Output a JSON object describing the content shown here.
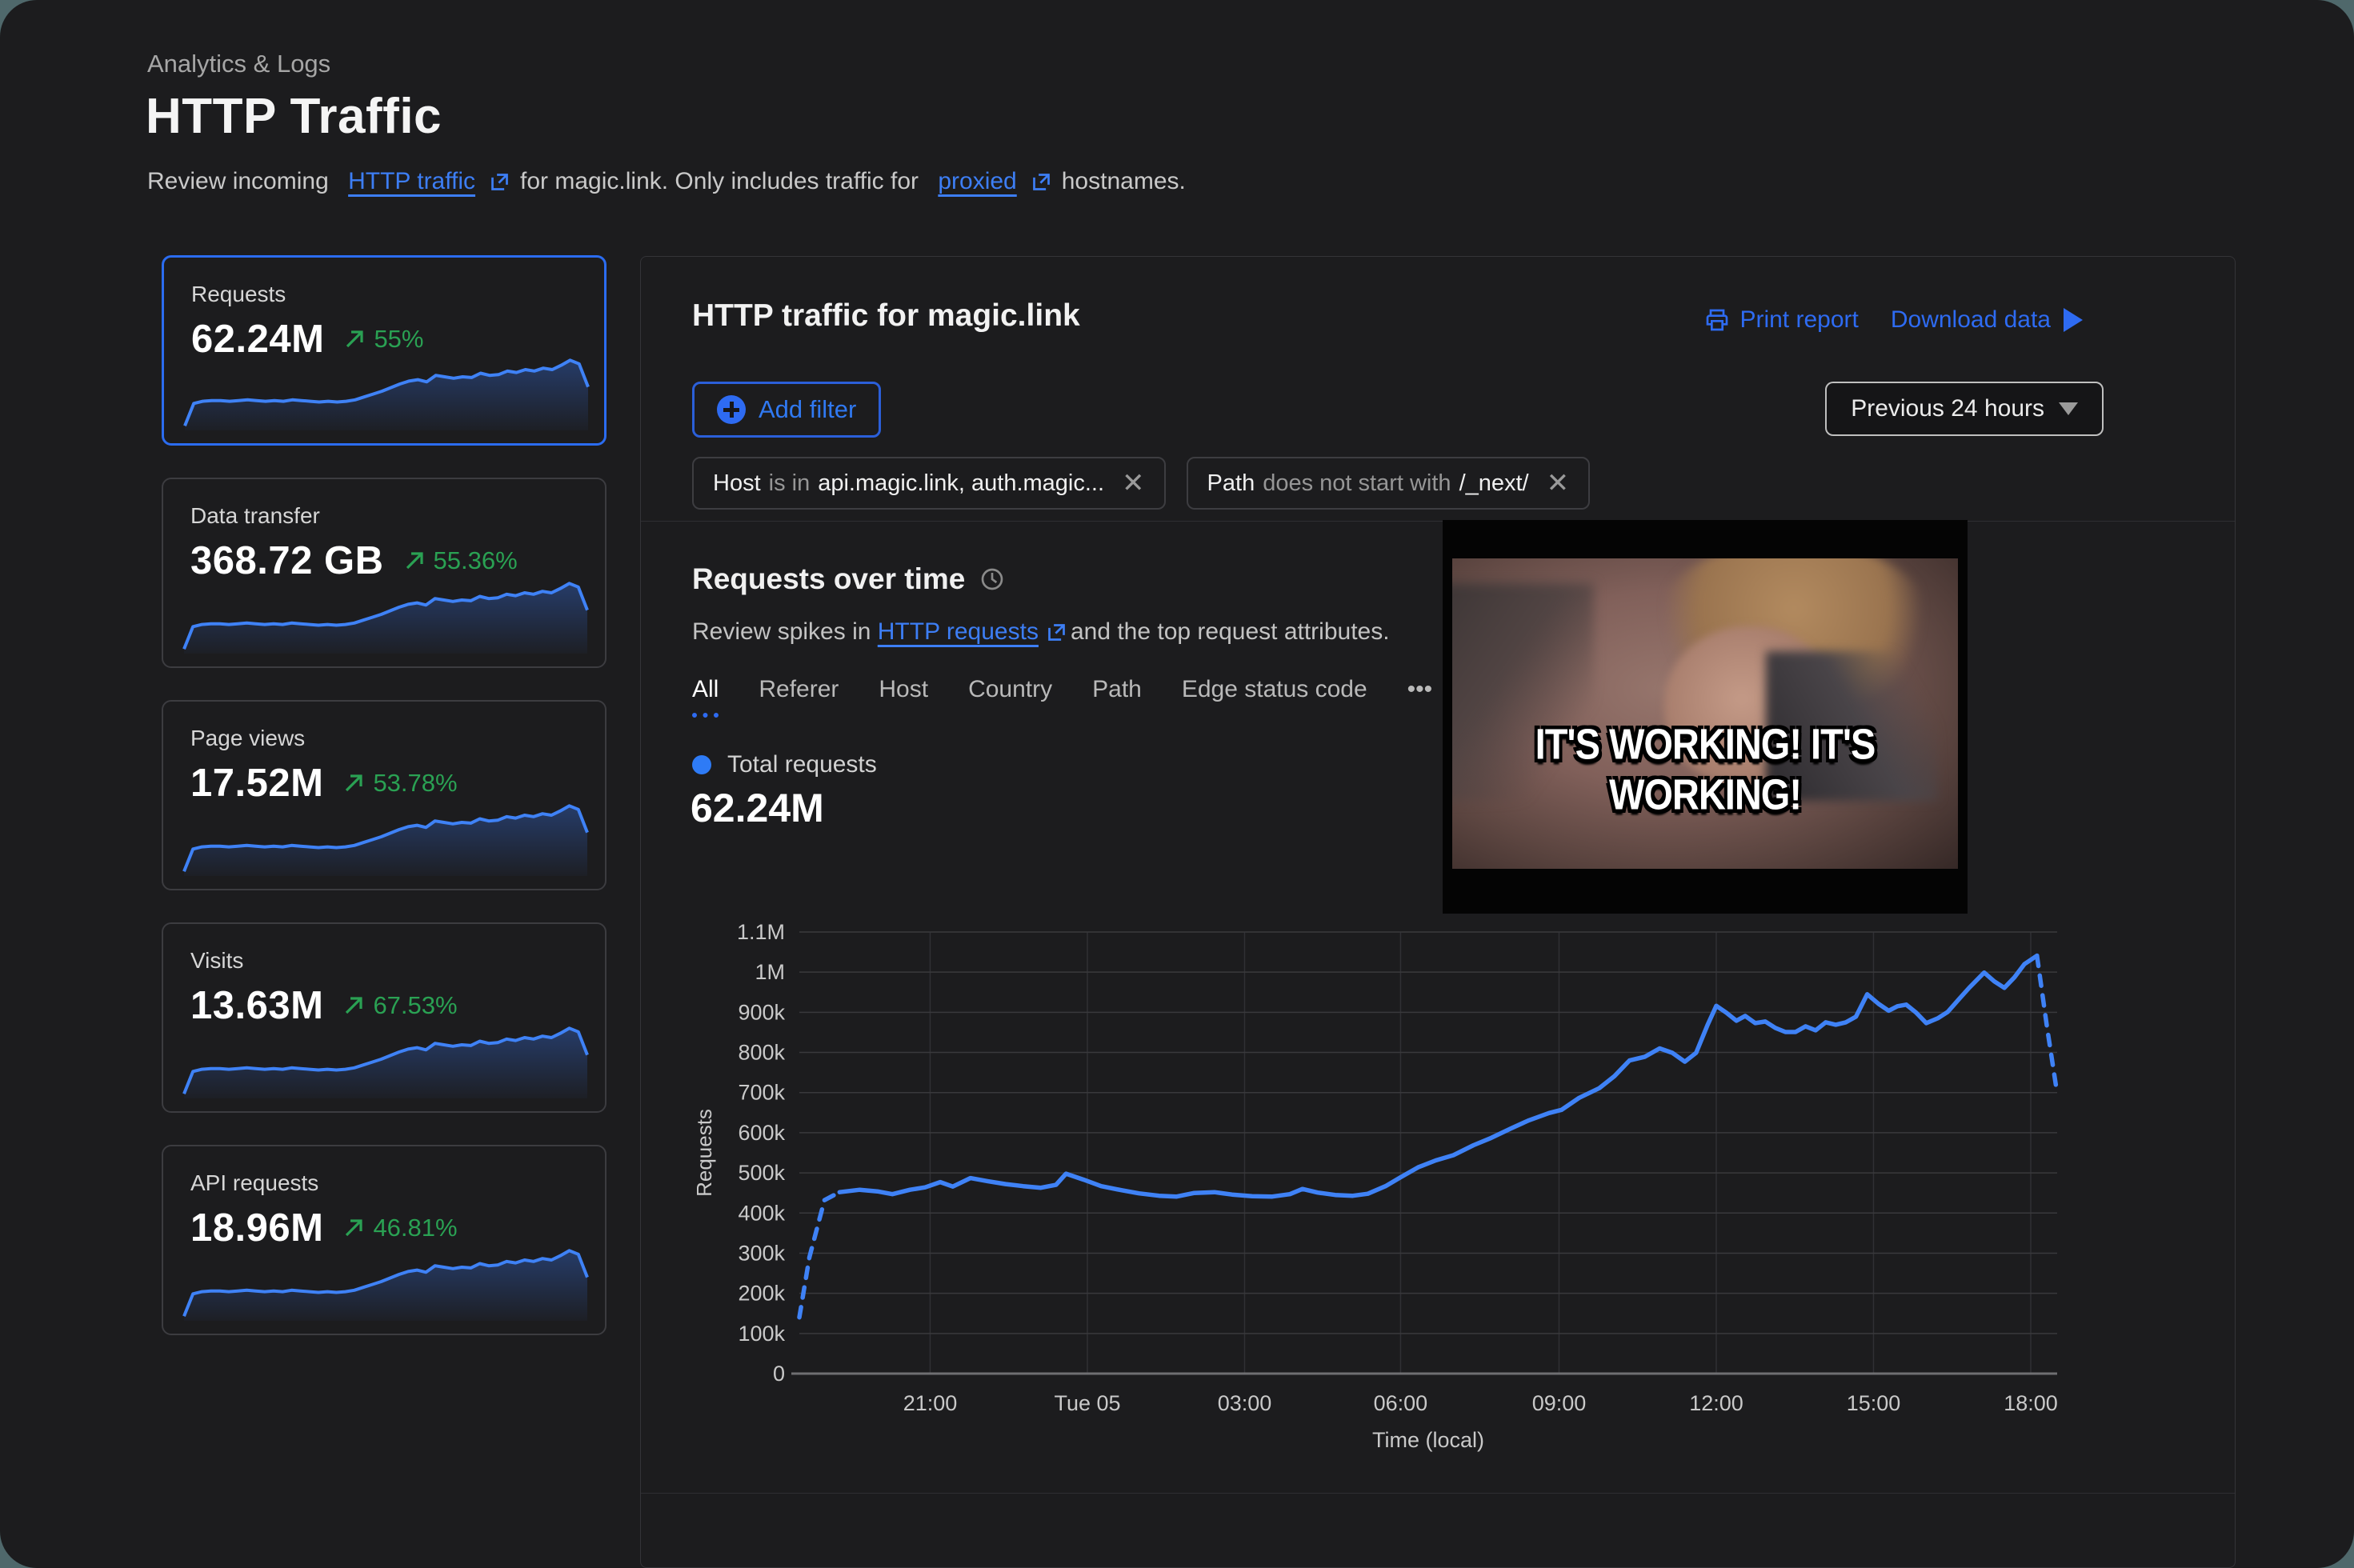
{
  "page": {
    "eyebrow": "Analytics & Logs",
    "title": "HTTP Traffic",
    "description": {
      "pre": "Review incoming",
      "link1": "HTTP traffic",
      "mid": "for magic.link. Only includes traffic for",
      "link2": "proxied",
      "post": "hostnames."
    }
  },
  "cards": [
    {
      "label": "Requests",
      "value": "62.24M",
      "delta": "55%"
    },
    {
      "label": "Data transfer",
      "value": "368.72 GB",
      "delta": "55.36%"
    },
    {
      "label": "Page views",
      "value": "17.52M",
      "delta": "53.78%"
    },
    {
      "label": "Visits",
      "value": "13.63M",
      "delta": "67.53%"
    },
    {
      "label": "API requests",
      "value": "18.96M",
      "delta": "46.81%"
    }
  ],
  "panel": {
    "title": "HTTP traffic for magic.link",
    "print_label": "Print report",
    "download_label": "Download data",
    "time_range": "Previous 24 hours",
    "add_filter_label": "Add filter",
    "filters": [
      {
        "field": "Host",
        "operator": "is in",
        "value": "api.magic.link, auth.magic...",
        "close": "✕"
      },
      {
        "field": "Path",
        "operator": "does not start with",
        "value": "/_next/",
        "close": "✕"
      }
    ]
  },
  "section": {
    "heading": "Requests over time",
    "description": {
      "pre": "Review spikes in",
      "link": "HTTP requests",
      "post": "and the top request attributes."
    },
    "tabs": [
      "All",
      "Referer",
      "Host",
      "Country",
      "Path",
      "Edge status code",
      "•••"
    ],
    "active_tab": "All",
    "legend_label": "Total requests",
    "total_value": "62.24M"
  },
  "meme": {
    "caption": "IT'S WORKING! IT'S WORKING!"
  },
  "colors": {
    "accent_blue": "#2e6bf2",
    "chart_line": "#3f82f6",
    "positive_green": "#2aa153",
    "grid": "#39393c",
    "axis_text": "#c9c9c9"
  },
  "sparkline": {
    "values": [
      0.02,
      0.33,
      0.36,
      0.37,
      0.37,
      0.36,
      0.37,
      0.38,
      0.37,
      0.36,
      0.37,
      0.36,
      0.38,
      0.37,
      0.36,
      0.35,
      0.36,
      0.35,
      0.36,
      0.38,
      0.42,
      0.46,
      0.5,
      0.55,
      0.6,
      0.64,
      0.66,
      0.63,
      0.72,
      0.7,
      0.68,
      0.7,
      0.69,
      0.75,
      0.72,
      0.73,
      0.78,
      0.76,
      0.8,
      0.78,
      0.82,
      0.8,
      0.86,
      0.93,
      0.88,
      0.56
    ]
  },
  "chart_data": {
    "type": "line",
    "title": "Requests over time",
    "xlabel": "Time (local)",
    "ylabel": "Requests",
    "ylim": [
      0,
      1100000
    ],
    "grid": true,
    "legend_position": "top-left",
    "y_ticks": [
      {
        "value": 0,
        "label": "0"
      },
      {
        "value": 100,
        "label": "100k"
      },
      {
        "value": 200,
        "label": "200k"
      },
      {
        "value": 300,
        "label": "300k"
      },
      {
        "value": 400,
        "label": "400k"
      },
      {
        "value": 500,
        "label": "500k"
      },
      {
        "value": 600,
        "label": "600k"
      },
      {
        "value": 700,
        "label": "700k"
      },
      {
        "value": 800,
        "label": "800k"
      },
      {
        "value": 900,
        "label": "900k"
      },
      {
        "value": 1000,
        "label": "1M"
      },
      {
        "value": 1100,
        "label": "1.1M"
      }
    ],
    "x_ticks": [
      {
        "frac": 0.104,
        "label": "21:00"
      },
      {
        "frac": 0.229,
        "label": "Tue 05"
      },
      {
        "frac": 0.354,
        "label": "03:00"
      },
      {
        "frac": 0.478,
        "label": "06:00"
      },
      {
        "frac": 0.604,
        "label": "09:00"
      },
      {
        "frac": 0.729,
        "label": "12:00"
      },
      {
        "frac": 0.854,
        "label": "15:00"
      },
      {
        "frac": 0.979,
        "label": "18:00"
      }
    ],
    "series": [
      {
        "name": "Total requests",
        "units": "requests, thousands",
        "dash_head_until": 3,
        "dash_tail_from": 87,
        "points": [
          [
            0.0,
            140
          ],
          [
            0.008,
            290
          ],
          [
            0.02,
            432
          ],
          [
            0.032,
            452
          ],
          [
            0.048,
            458
          ],
          [
            0.062,
            454
          ],
          [
            0.074,
            447
          ],
          [
            0.088,
            458
          ],
          [
            0.1,
            464
          ],
          [
            0.112,
            477
          ],
          [
            0.122,
            466
          ],
          [
            0.136,
            487
          ],
          [
            0.15,
            479
          ],
          [
            0.164,
            472
          ],
          [
            0.178,
            467
          ],
          [
            0.192,
            463
          ],
          [
            0.204,
            470
          ],
          [
            0.212,
            498
          ],
          [
            0.226,
            483
          ],
          [
            0.24,
            467
          ],
          [
            0.256,
            457
          ],
          [
            0.27,
            449
          ],
          [
            0.286,
            443
          ],
          [
            0.3,
            441
          ],
          [
            0.314,
            450
          ],
          [
            0.33,
            452
          ],
          [
            0.344,
            446
          ],
          [
            0.36,
            442
          ],
          [
            0.376,
            441
          ],
          [
            0.39,
            447
          ],
          [
            0.4,
            460
          ],
          [
            0.412,
            451
          ],
          [
            0.426,
            445
          ],
          [
            0.44,
            443
          ],
          [
            0.452,
            448
          ],
          [
            0.466,
            467
          ],
          [
            0.478,
            489
          ],
          [
            0.492,
            514
          ],
          [
            0.506,
            531
          ],
          [
            0.52,
            544
          ],
          [
            0.536,
            569
          ],
          [
            0.55,
            587
          ],
          [
            0.566,
            611
          ],
          [
            0.58,
            631
          ],
          [
            0.596,
            649
          ],
          [
            0.606,
            657
          ],
          [
            0.62,
            687
          ],
          [
            0.636,
            711
          ],
          [
            0.648,
            741
          ],
          [
            0.66,
            780
          ],
          [
            0.672,
            789
          ],
          [
            0.684,
            810
          ],
          [
            0.694,
            799
          ],
          [
            0.704,
            777
          ],
          [
            0.713,
            799
          ],
          [
            0.722,
            868
          ],
          [
            0.729,
            916
          ],
          [
            0.737,
            899
          ],
          [
            0.745,
            879
          ],
          [
            0.752,
            891
          ],
          [
            0.76,
            873
          ],
          [
            0.768,
            877
          ],
          [
            0.776,
            861
          ],
          [
            0.784,
            851
          ],
          [
            0.792,
            851
          ],
          [
            0.8,
            865
          ],
          [
            0.808,
            855
          ],
          [
            0.816,
            875
          ],
          [
            0.824,
            869
          ],
          [
            0.832,
            875
          ],
          [
            0.84,
            889
          ],
          [
            0.849,
            945
          ],
          [
            0.858,
            921
          ],
          [
            0.866,
            904
          ],
          [
            0.873,
            915
          ],
          [
            0.88,
            919
          ],
          [
            0.888,
            899
          ],
          [
            0.896,
            873
          ],
          [
            0.905,
            885
          ],
          [
            0.913,
            901
          ],
          [
            0.922,
            933
          ],
          [
            0.93,
            961
          ],
          [
            0.942,
            999
          ],
          [
            0.95,
            977
          ],
          [
            0.958,
            961
          ],
          [
            0.966,
            987
          ],
          [
            0.974,
            1020
          ],
          [
            0.984,
            1041
          ],
          [
            0.992,
            862
          ],
          [
            1.0,
            698
          ]
        ]
      }
    ]
  }
}
